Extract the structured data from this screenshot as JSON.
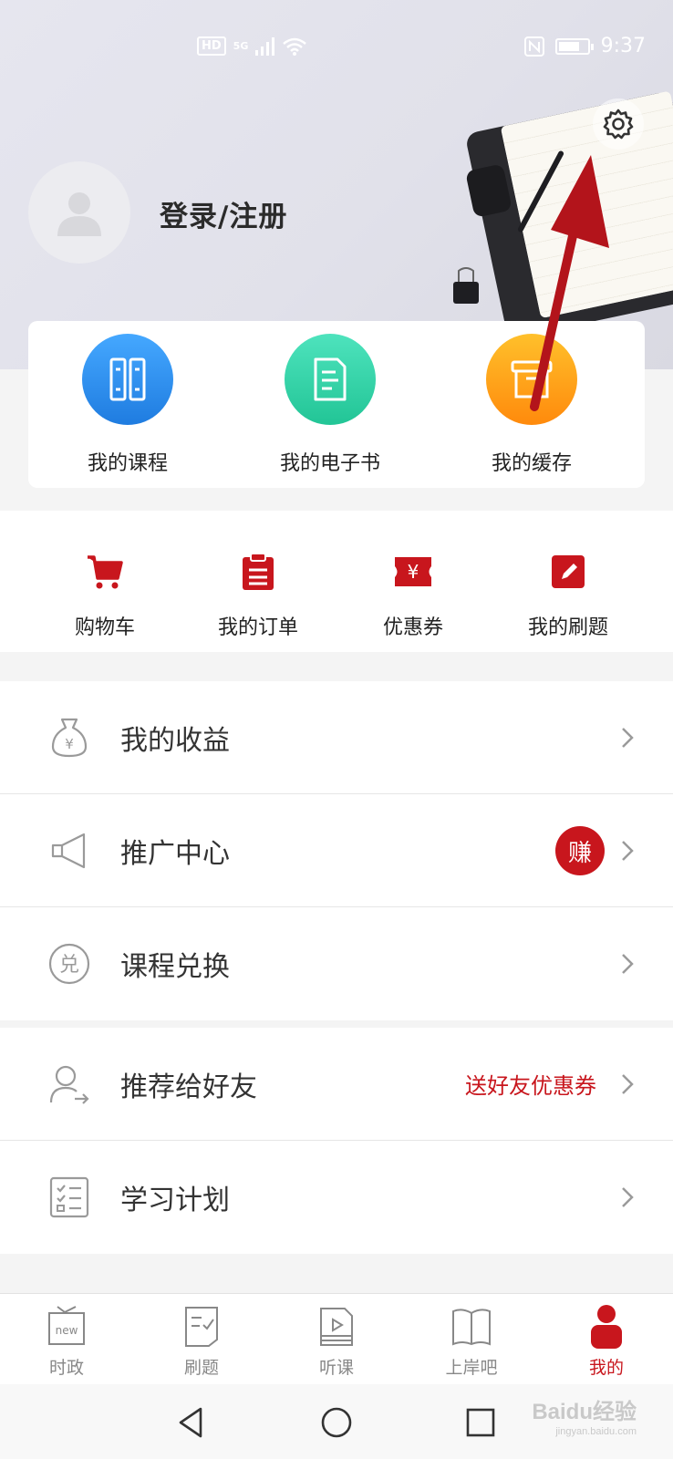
{
  "status_bar": {
    "hd_label": "HD",
    "network_label": "5G",
    "time": "9:37"
  },
  "profile": {
    "login_label": "登录/注册"
  },
  "quick_actions": [
    {
      "label": "我的课程",
      "icon": "book-icon",
      "color": "#2f8fef"
    },
    {
      "label": "我的电子书",
      "icon": "document-icon",
      "color": "#2fd6aa"
    },
    {
      "label": "我的缓存",
      "icon": "box-icon",
      "color": "#ffa11a"
    }
  ],
  "icon_row": [
    {
      "label": "购物车",
      "icon": "cart-icon"
    },
    {
      "label": "我的订单",
      "icon": "clipboard-icon"
    },
    {
      "label": "优惠券",
      "icon": "coupon-icon"
    },
    {
      "label": "我的刷题",
      "icon": "edit-icon"
    }
  ],
  "menu_group1": [
    {
      "label": "我的收益",
      "icon": "money-bag-icon"
    },
    {
      "label": "推广中心",
      "icon": "megaphone-icon",
      "badge": "赚"
    },
    {
      "label": "课程兑换",
      "icon": "exchange-icon"
    }
  ],
  "menu_group2": [
    {
      "label": "推荐给好友",
      "icon": "share-user-icon",
      "promo": "送好友优惠券"
    },
    {
      "label": "学习计划",
      "icon": "checklist-icon"
    }
  ],
  "bottom_nav": [
    {
      "label": "时政",
      "icon": "tv-new-icon",
      "active": false
    },
    {
      "label": "刷题",
      "icon": "exam-icon",
      "active": false
    },
    {
      "label": "听课",
      "icon": "play-book-icon",
      "active": false
    },
    {
      "label": "上岸吧",
      "icon": "open-book-icon",
      "active": false
    },
    {
      "label": "我的",
      "icon": "user-icon",
      "active": true
    }
  ],
  "watermark": {
    "brand": "Baidu经验",
    "url": "jingyan.baidu.com"
  },
  "colors": {
    "accent": "#c8161d",
    "annotation_arrow": "#b3141b"
  }
}
